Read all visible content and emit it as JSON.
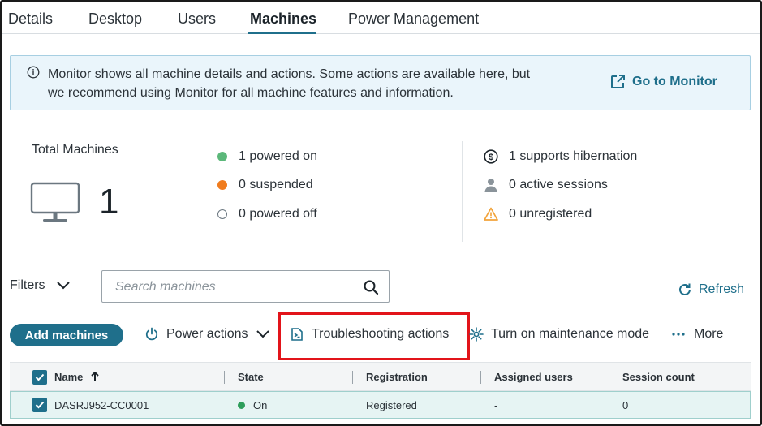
{
  "tabs": [
    {
      "label": "Details"
    },
    {
      "label": "Desktop"
    },
    {
      "label": "Users"
    },
    {
      "label": "Machines",
      "active": true
    },
    {
      "label": "Power Management"
    }
  ],
  "banner": {
    "line1": "Monitor shows all machine details and actions. Some actions are available here, but",
    "line2": "we recommend using Monitor for all machine features and information.",
    "link_label": "Go to Monitor"
  },
  "summary": {
    "title": "Total Machines",
    "count": "1",
    "stats_left": [
      {
        "label": "1 powered on",
        "status": "on",
        "color": "#5cb87a"
      },
      {
        "label": "0 suspended",
        "status": "suspended",
        "color": "#f07c1e"
      },
      {
        "label": "0 powered off",
        "status": "off",
        "color": "#ffffff"
      }
    ],
    "stats_right": [
      {
        "label": "1 supports hibernation",
        "icon": "hibernation-icon"
      },
      {
        "label": "0 active sessions",
        "icon": "user-icon"
      },
      {
        "label": "0 unregistered",
        "icon": "warning-icon"
      }
    ]
  },
  "filters": {
    "label": "Filters",
    "search_placeholder": "Search machines",
    "refresh_label": "Refresh"
  },
  "toolbar": {
    "add_label": "Add machines",
    "power_label": "Power actions",
    "troubleshoot_label": "Troubleshooting actions",
    "maintenance_label": "Turn on maintenance mode",
    "more_label": "More"
  },
  "table": {
    "columns": [
      "Name",
      "State",
      "Registration",
      "Assigned users",
      "Session count"
    ],
    "rows": [
      {
        "name": "DASRJ952-CC0001",
        "state": "On",
        "registration": "Registered",
        "assigned_users": "-",
        "session_count": "0"
      }
    ]
  },
  "colors": {
    "accent": "#1f6f8b",
    "highlight": "#e2141a",
    "on": "#5cb87a",
    "suspended": "#f07c1e",
    "warning": "#f2a33a"
  }
}
